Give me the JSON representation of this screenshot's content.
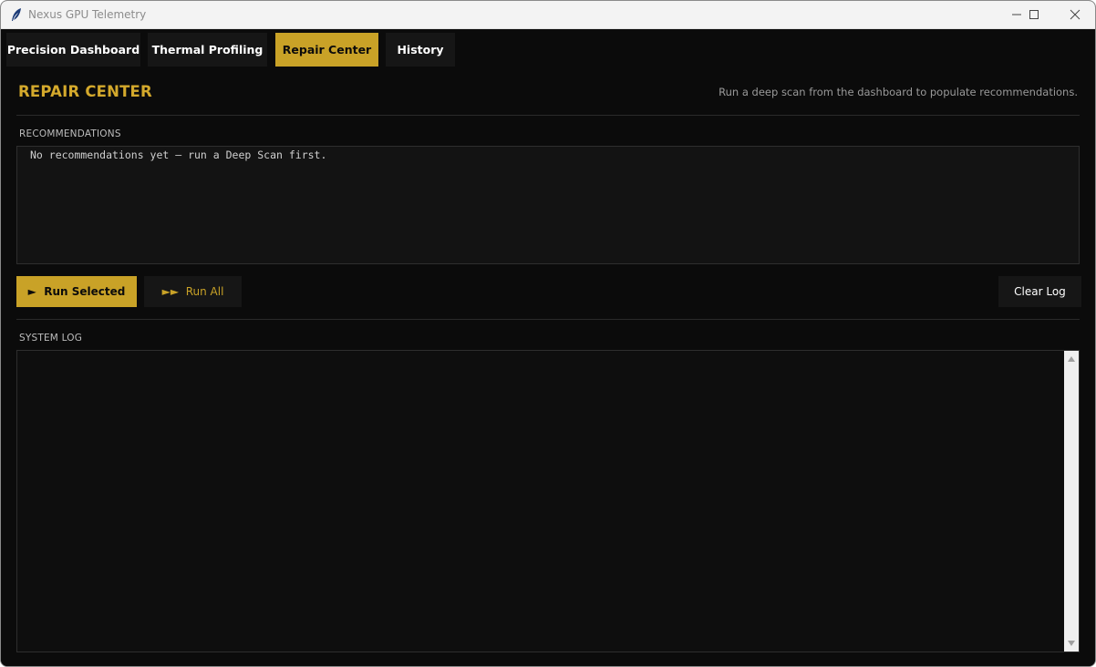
{
  "window": {
    "title": "Nexus GPU Telemetry",
    "icon": "feather-icon"
  },
  "tabs": [
    {
      "label": "Precision Dashboard",
      "active": false
    },
    {
      "label": "Thermal Profiling",
      "active": false
    },
    {
      "label": "Repair Center",
      "active": true
    },
    {
      "label": "History",
      "active": false
    }
  ],
  "header": {
    "title": "REPAIR CENTER",
    "hint": "Run a deep scan from the dashboard to populate recommendations."
  },
  "recommendations": {
    "label": "RECOMMENDATIONS",
    "text": "No recommendations yet — run a Deep Scan first."
  },
  "actions": {
    "run_selected": "Run Selected",
    "run_all": "Run All",
    "clear_log": "Clear Log"
  },
  "system_log": {
    "label": "SYSTEM LOG",
    "text": ""
  },
  "colors": {
    "accent": "#c9a227",
    "background": "#0b0b0b",
    "panel": "#161616"
  }
}
